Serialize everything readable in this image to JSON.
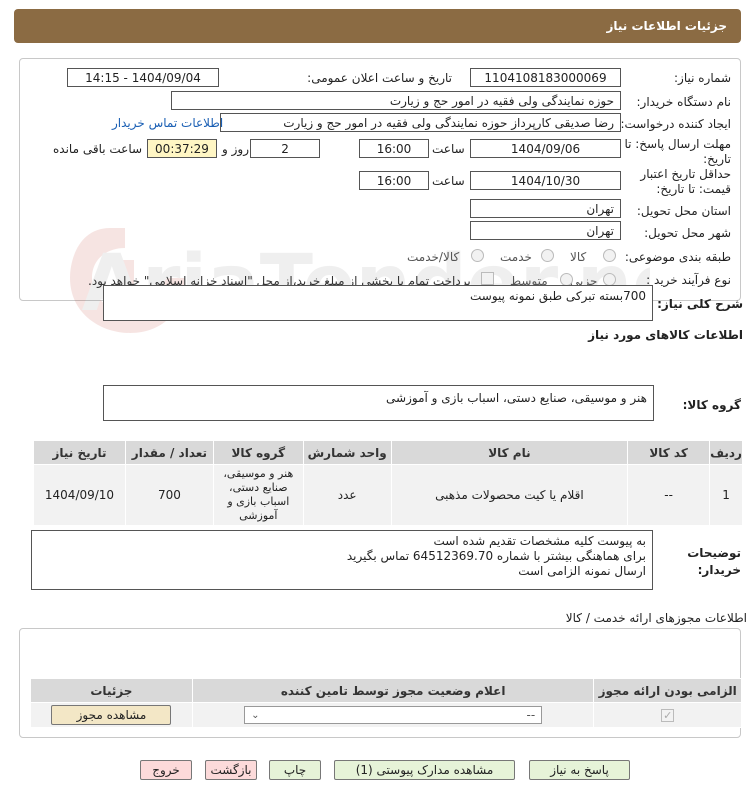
{
  "header": {
    "title": "جزئیات اطلاعات نیاز"
  },
  "form": {
    "need_number_label": "شماره نیاز:",
    "need_number": "1104108183000069",
    "announce_label": "تاریخ و ساعت اعلان عمومی:",
    "announce_value": "1404/09/04 - 14:15",
    "buyer_label": "نام دستگاه خریدار:",
    "buyer_value": "حوزه نمایندگی ولی فقیه در امور حج و زیارت",
    "creator_label": "ایجاد کننده درخواست:",
    "creator_value": "رضا صدیقی کارپرداز حوزه نمایندگی ولی فقیه در امور حج و زیارت",
    "contact_link": "اطلاعات تماس خریدار",
    "deadline_label_1": "مهلت ارسال پاسخ: تا",
    "deadline_label_2": "تاریخ:",
    "deadline_date": "1404/09/06",
    "time_label": "ساعت",
    "deadline_time": "16:00",
    "days_value": "2",
    "days_label": "روز و",
    "remaining_value": "00:37:29",
    "remaining_label": "ساعت باقی مانده",
    "validity_label_1": "حداقل تاریخ اعتبار",
    "validity_label_2": "قیمت: تا تاریخ:",
    "validity_date": "1404/10/30",
    "validity_time": "16:00",
    "province_label": "استان محل تحویل:",
    "province_value": "تهران",
    "city_label": "شهر محل تحویل:",
    "city_value": "تهران",
    "category_label": "طبقه بندی موضوعی:",
    "category_options": [
      "کالا",
      "خدمت",
      "کالا/خدمت"
    ],
    "process_label": "نوع فرآیند خرید :",
    "process_options": [
      "جزیی",
      "متوسط"
    ],
    "payment_note": "پرداخت تمام یا بخشی از مبلغ خرید،از محل \"اسناد خزانه اسلامی\" خواهد بود."
  },
  "summary": {
    "label": "شرح کلی نیاز:",
    "value": "700بسته تبرکی طبق نمونه پیوست"
  },
  "goods": {
    "section_title": "اطلاعات کالاهای مورد نیاز",
    "group_label": "گروه کالا:",
    "group_value": "هنر و موسیقی، صنایع دستی، اسباب بازی و آموزشی",
    "columns": [
      "ردیف",
      "کد کالا",
      "نام کالا",
      "واحد شمارش",
      "گروه کالا",
      "تعداد / مقدار",
      "تاریخ نیاز"
    ],
    "rows": [
      {
        "row": "1",
        "code": "--",
        "name": "اقلام یا کیت محصولات مذهبی",
        "unit": "عدد",
        "group": "هنر و موسیقی، صنایع دستی، اسباب بازی و آموزشی",
        "qty": "700",
        "date": "1404/09/10"
      }
    ]
  },
  "buyer_notes": {
    "label_1": "توضیحات",
    "label_2": "خریدار:",
    "line1": "به پیوست کلیه مشخصات تقدیم شده است",
    "line2": "برای هماهنگی بیشتر با شماره 64512369.70 تماس بگیرید",
    "line3": "ارسال نمونه الزامی است"
  },
  "permits": {
    "title": "اطلاعات مجوزهای ارائه خدمت / کالا",
    "columns": [
      "الزامی بودن ارائه مجوز",
      "اعلام وضعیت مجوز توسط تامین کننده",
      "جزئیات"
    ],
    "select_value": "--",
    "view_button": "مشاهده مجوز"
  },
  "actions": {
    "reply": "پاسخ به نیاز",
    "docs": "مشاهده مدارک پیوستی (1)",
    "print": "چاپ",
    "back": "بازگشت",
    "exit": "خروج"
  },
  "watermark": {
    "brand": "AriaTender.neT"
  },
  "colors": {
    "header": "#8b6b43",
    "button_green": "#e6f3d8",
    "button_pink": "#fcdada",
    "highlight": "#fff6c4",
    "link": "#1a5fb4"
  }
}
